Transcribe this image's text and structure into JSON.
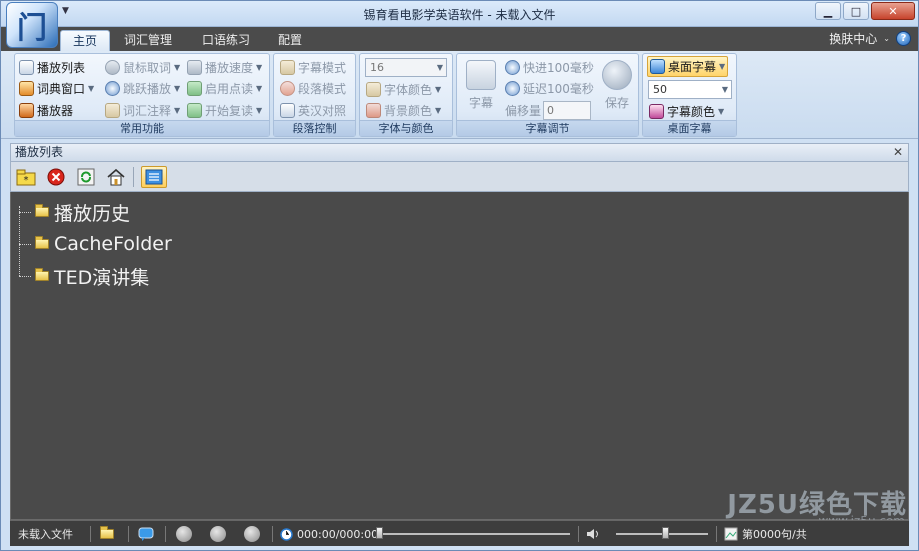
{
  "window": {
    "title": "锡育看电影学英语软件 - 未载入文件",
    "logo_text": "门"
  },
  "tabs": [
    {
      "label": "主页",
      "active": true
    },
    {
      "label": "词汇管理",
      "active": false
    },
    {
      "label": "口语练习",
      "active": false
    },
    {
      "label": "配置",
      "active": false
    }
  ],
  "tabbar_right": {
    "skin_label": "换肤中心",
    "help_glyph": "?"
  },
  "ribbon": {
    "common": {
      "label": "常用功能",
      "playlist": "播放列表",
      "dict_window": "词典窗口",
      "player": "播放器",
      "mouse_lookup": "鼠标取词",
      "jump_play": "跳跃播放",
      "vocab_note": "词汇注释",
      "play_speed": "播放速度",
      "enable_read": "启用点读",
      "start_review": "开始复读"
    },
    "paragraph": {
      "label": "段落控制",
      "subtitle_mode": "字幕模式",
      "paragraph_mode": "段落模式",
      "en_cn_compare": "英汉对照"
    },
    "font_color": {
      "label": "字体与颜色",
      "font_size": "16",
      "font_color": "字体颜色",
      "bg_color": "背景颜色"
    },
    "subtitle_adjust": {
      "label": "字幕调节",
      "subtitle": "字幕",
      "fast_forward": "快进100毫秒",
      "delay": "延迟100毫秒",
      "offset_label": "偏移量",
      "offset_value": "0",
      "save": "保存"
    },
    "desktop_subtitle": {
      "label": "桌面字幕",
      "desktop_subtitle": "桌面字幕",
      "size_value": "50",
      "subtitle_color": "字幕颜色"
    }
  },
  "panel": {
    "title": "播放列表",
    "close_glyph": "✕"
  },
  "tree": {
    "items": [
      {
        "label": "播放历史"
      },
      {
        "label": "CacheFolder"
      },
      {
        "label": "TED演讲集"
      }
    ]
  },
  "statusbar": {
    "file_status": "未载入文件",
    "time": "000:00/000:00",
    "sentence": "第0000句/共"
  },
  "watermark": {
    "main": "JZ5U绿色下载",
    "sub": "www.jz5u.com"
  },
  "colors": {
    "ribbon_bg": "#dde9f6",
    "tree_bg": "#4a4a4a",
    "accent": "#ffd46a"
  }
}
